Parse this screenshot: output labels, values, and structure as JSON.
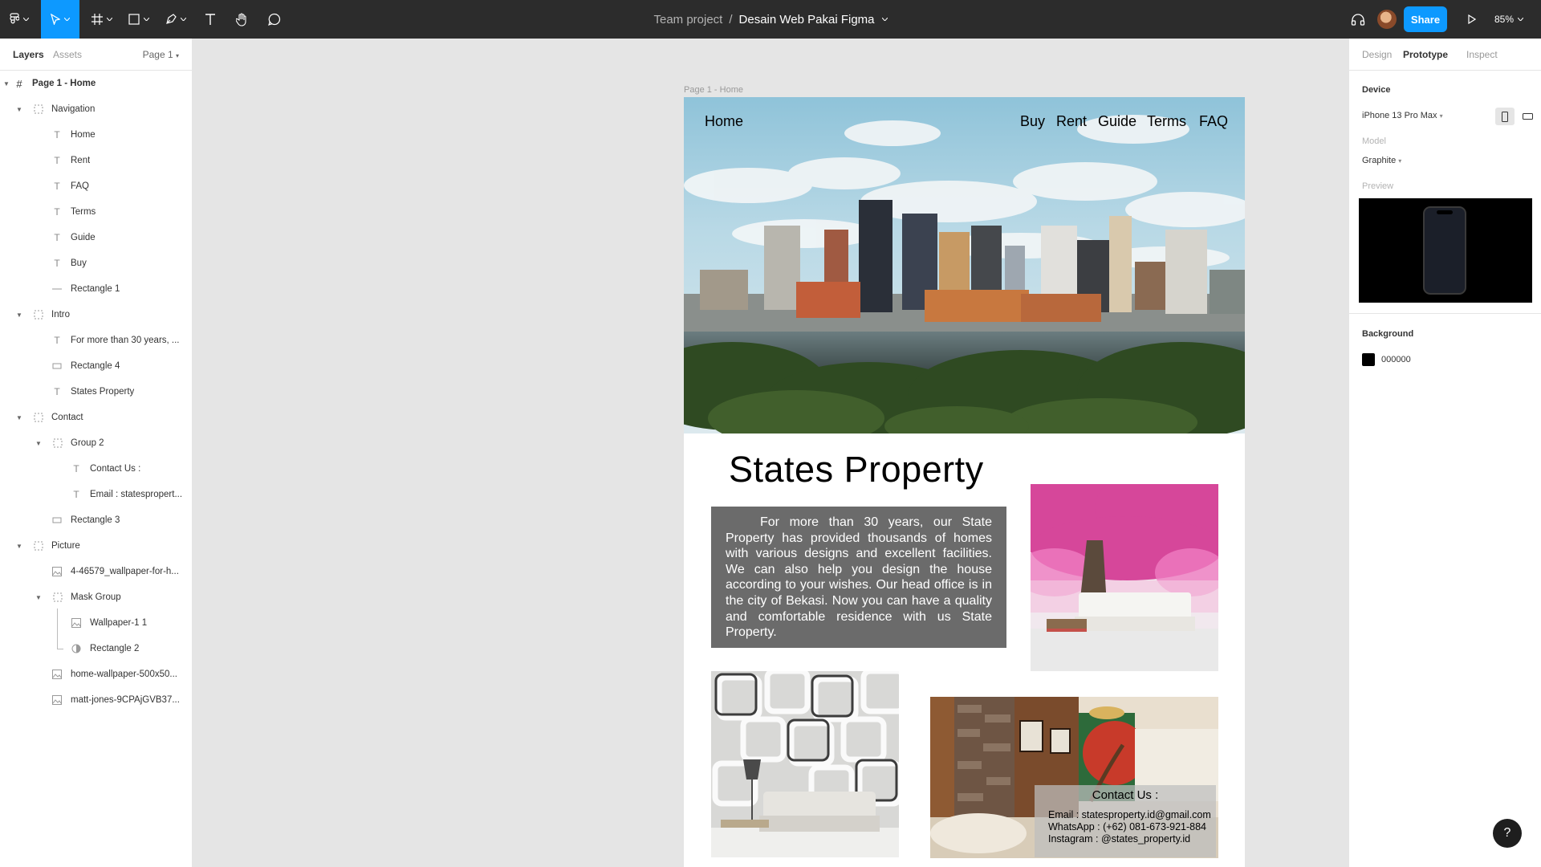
{
  "toolbar": {
    "project": "Team project",
    "separator": "/",
    "file_name": "Desain Web Pakai Figma",
    "share_label": "Share",
    "zoom": "85%"
  },
  "left_panel": {
    "tab_layers": "Layers",
    "tab_assets": "Assets",
    "page_select": "Page 1",
    "layers": [
      {
        "label": "Page 1 - Home"
      },
      {
        "label": "Navigation"
      },
      {
        "label": "Home"
      },
      {
        "label": "Rent"
      },
      {
        "label": "FAQ"
      },
      {
        "label": "Terms"
      },
      {
        "label": "Guide"
      },
      {
        "label": "Buy"
      },
      {
        "label": "Rectangle 1"
      },
      {
        "label": "Intro"
      },
      {
        "label": "For more than 30 years, ..."
      },
      {
        "label": "Rectangle 4"
      },
      {
        "label": "States Property"
      },
      {
        "label": "Contact"
      },
      {
        "label": "Group 2"
      },
      {
        "label": "Contact Us :"
      },
      {
        "label": "Email : statespropert..."
      },
      {
        "label": "Rectangle 3"
      },
      {
        "label": "Picture"
      },
      {
        "label": "4-46579_wallpaper-for-h..."
      },
      {
        "label": "Mask Group"
      },
      {
        "label": "Wallpaper-1 1"
      },
      {
        "label": "Rectangle 2"
      },
      {
        "label": "home-wallpaper-500x50..."
      },
      {
        "label": "matt-jones-9CPAjGVB37..."
      }
    ]
  },
  "canvas": {
    "frame_label": "Page 1 - Home",
    "nav": {
      "home": "Home",
      "links": [
        "Buy",
        "Rent",
        "Guide",
        "Terms",
        "FAQ"
      ]
    },
    "title": "States Property",
    "intro": "For more than 30 years, our State Property has provided thousands of homes with various designs and excellent facilities. We can also help you design the house according to your wishes. Our head office is in the city of Bekasi. Now you can have a quality and comfortable residence with us State Property.",
    "contact": {
      "title": "Contact Us :",
      "email": "Email : statesproperty.id@gmail.com",
      "whatsapp": "WhatsApp : (+62) 081-673-921-884",
      "instagram": "Instagram : @states_property.id"
    }
  },
  "right_panel": {
    "tab_design": "Design",
    "tab_prototype": "Prototype",
    "tab_inspect": "Inspect",
    "device_heading": "Device",
    "device_value": "iPhone 13 Pro Max",
    "model_label": "Model",
    "model_value": "Graphite",
    "preview_label": "Preview",
    "background_heading": "Background",
    "background_value": "000000"
  },
  "help_label": "?",
  "colors": {
    "toolbar_bg": "#2c2c2c",
    "accent": "#0d99ff",
    "canvas_bg": "#e5e5e5",
    "intro_box": "#6b6b6b"
  },
  "icons": [
    "figma-menu-icon",
    "move-tool-icon",
    "frame-tool-icon",
    "shape-tool-icon",
    "pen-tool-icon",
    "text-tool-icon",
    "hand-tool-icon",
    "comment-tool-icon",
    "headphones-icon",
    "play-icon"
  ]
}
